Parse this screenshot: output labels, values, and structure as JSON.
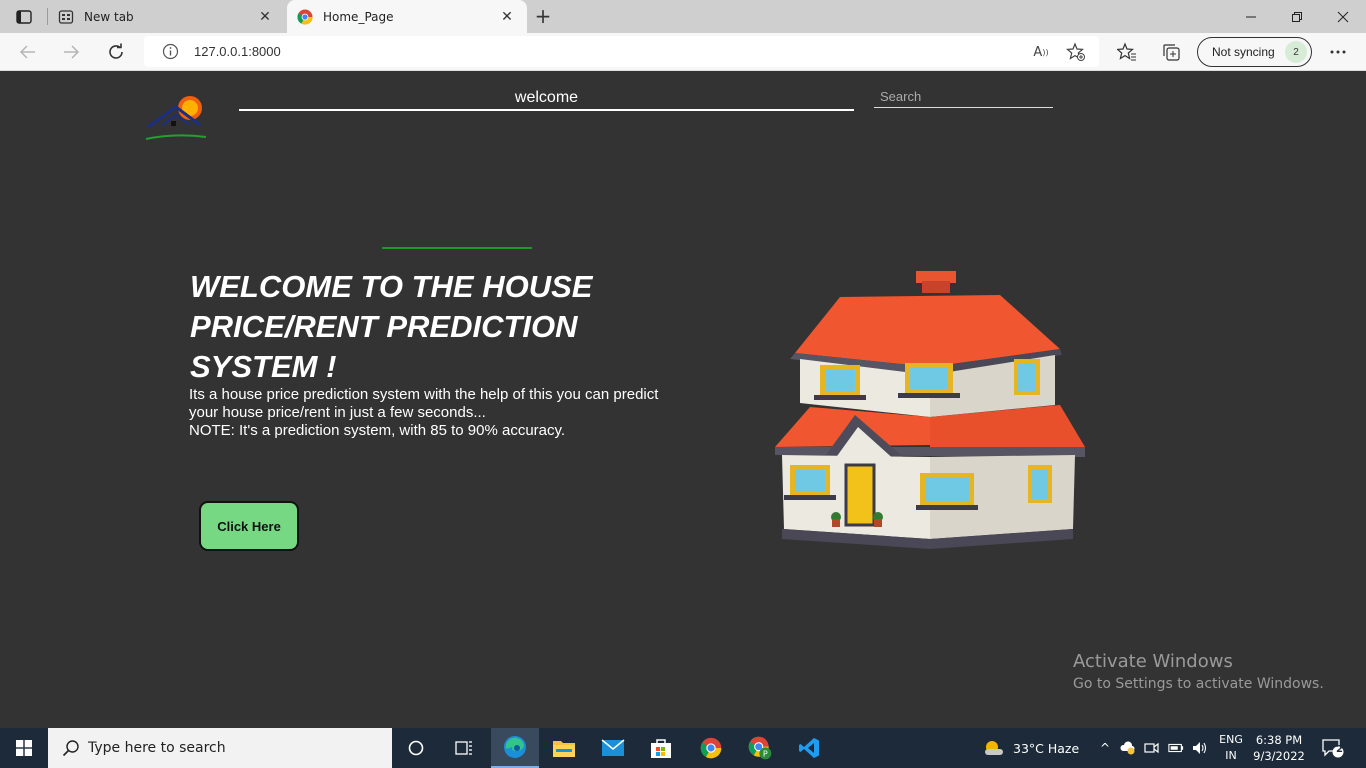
{
  "browser": {
    "tabs": [
      {
        "title": "New tab",
        "active": false,
        "icon": "new-tab-page-icon"
      },
      {
        "title": "Home_Page",
        "active": true,
        "icon": "chrome-logo-icon"
      }
    ],
    "url": "127.0.0.1:8000",
    "profile": {
      "label": "Not syncing",
      "badge": "2"
    }
  },
  "page": {
    "nav_title": "welcome",
    "search_placeholder": "Search",
    "hero_title": "WELCOME TO THE HOUSE PRICE/RENT PREDICTION SYSTEM !",
    "hero_line1": "Its a house price prediction system with the help of this you can predict your house price/rent in just a few seconds...",
    "hero_line2": "NOTE: It's a prediction system, with 85 to 90% accuracy.",
    "button_label": "Click Here",
    "accent_color": "#77d884",
    "background_color": "#333333"
  },
  "watermark": {
    "line1": "Activate Windows",
    "line2": "Go to Settings to activate Windows."
  },
  "taskbar": {
    "search_placeholder": "Type here to search",
    "weather": "33°C  Haze",
    "lang_line1": "ENG",
    "lang_line2": "IN",
    "time": "6:38 PM",
    "date": "9/3/2022",
    "notification_count": "2"
  }
}
